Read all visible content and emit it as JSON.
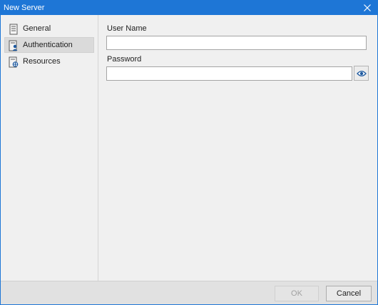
{
  "window": {
    "title": "New Server",
    "close_icon": "close-icon"
  },
  "sidebar": {
    "items": [
      {
        "label": "General",
        "icon": "server-icon",
        "selected": false
      },
      {
        "label": "Authentication",
        "icon": "user-auth-icon",
        "selected": true
      },
      {
        "label": "Resources",
        "icon": "resources-icon",
        "selected": false
      }
    ]
  },
  "form": {
    "username": {
      "label": "User Name",
      "value": ""
    },
    "password": {
      "label": "Password",
      "value": "",
      "reveal_icon": "eye-icon"
    }
  },
  "footer": {
    "ok_label": "OK",
    "ok_disabled": true,
    "cancel_label": "Cancel"
  },
  "colors": {
    "titlebar": "#1e76d6",
    "accent": "#1e5aa0"
  }
}
